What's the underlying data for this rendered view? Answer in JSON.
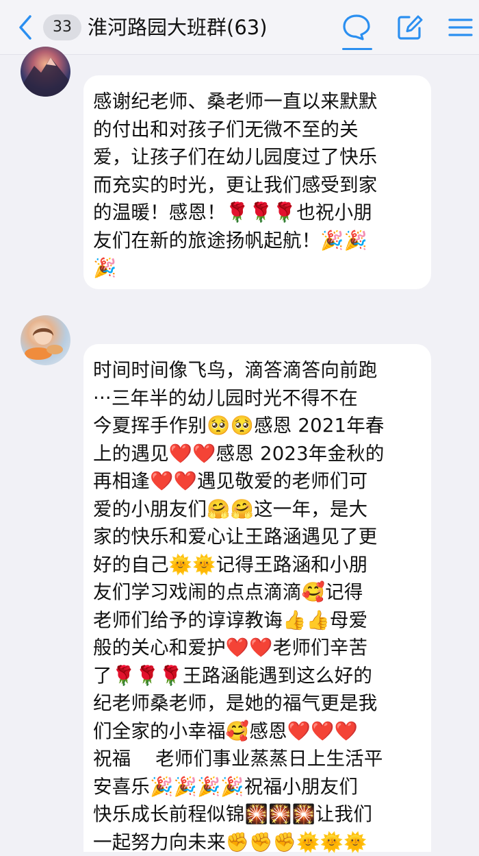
{
  "header": {
    "unread_count": "33",
    "title": "淮河路园大班群(63)",
    "accent_color": "#2b8ff0",
    "icons": [
      "back-chevron-icon",
      "chat-bubble-icon",
      "edit-note-icon",
      "menu-icon"
    ]
  },
  "messages": [
    {
      "avatar": "mountain-sunset-avatar",
      "text": "感谢纪老师、桑老师一直以来默默\n的付出和对孩子们无微不至的关\n爱，让孩子们在幼儿园度过了快乐\n而充实的时光，更让我们感受到家\n的温暖！感恩！🌹🌹🌹也祝小朋\n友们在新的旅途扬帆起航！🎉🎉\n🎉"
    },
    {
      "avatar": "cartoon-girl-avatar",
      "text": "时间时间像飞鸟，滴答滴答向前跑\n···三年半的幼儿园时光不得不在\n今夏挥手作别🥺🥺感恩 2021年春\n上的遇见❤️❤️感恩 2023年金秋的\n再相逢❤️❤️遇见敬爱的老师们可\n爱的小朋友们🤗🤗这一年，是大\n家的快乐和爱心让王路涵遇见了更\n好的自己🌞🌞记得王路涵和小朋\n友们学习戏闹的点点滴滴🥰记得\n老师们给予的谆谆教诲👍👍母爱\n般的关心和爱护❤️❤️老师们辛苦\n了🌹🌹🌹王路涵能遇到这么好的\n纪老师桑老师，是她的福气更是我\n们全家的小幸福🥰感恩❤️❤️❤️\n祝福    老师们事业蒸蒸日上生活平\n安喜乐🎉🎉🎉🎉祝福小朋友们\n快乐成长前程似锦🎇🎇🎇让我们\n一起努力向未来✊✊✊🌞🌞🌞"
    }
  ]
}
